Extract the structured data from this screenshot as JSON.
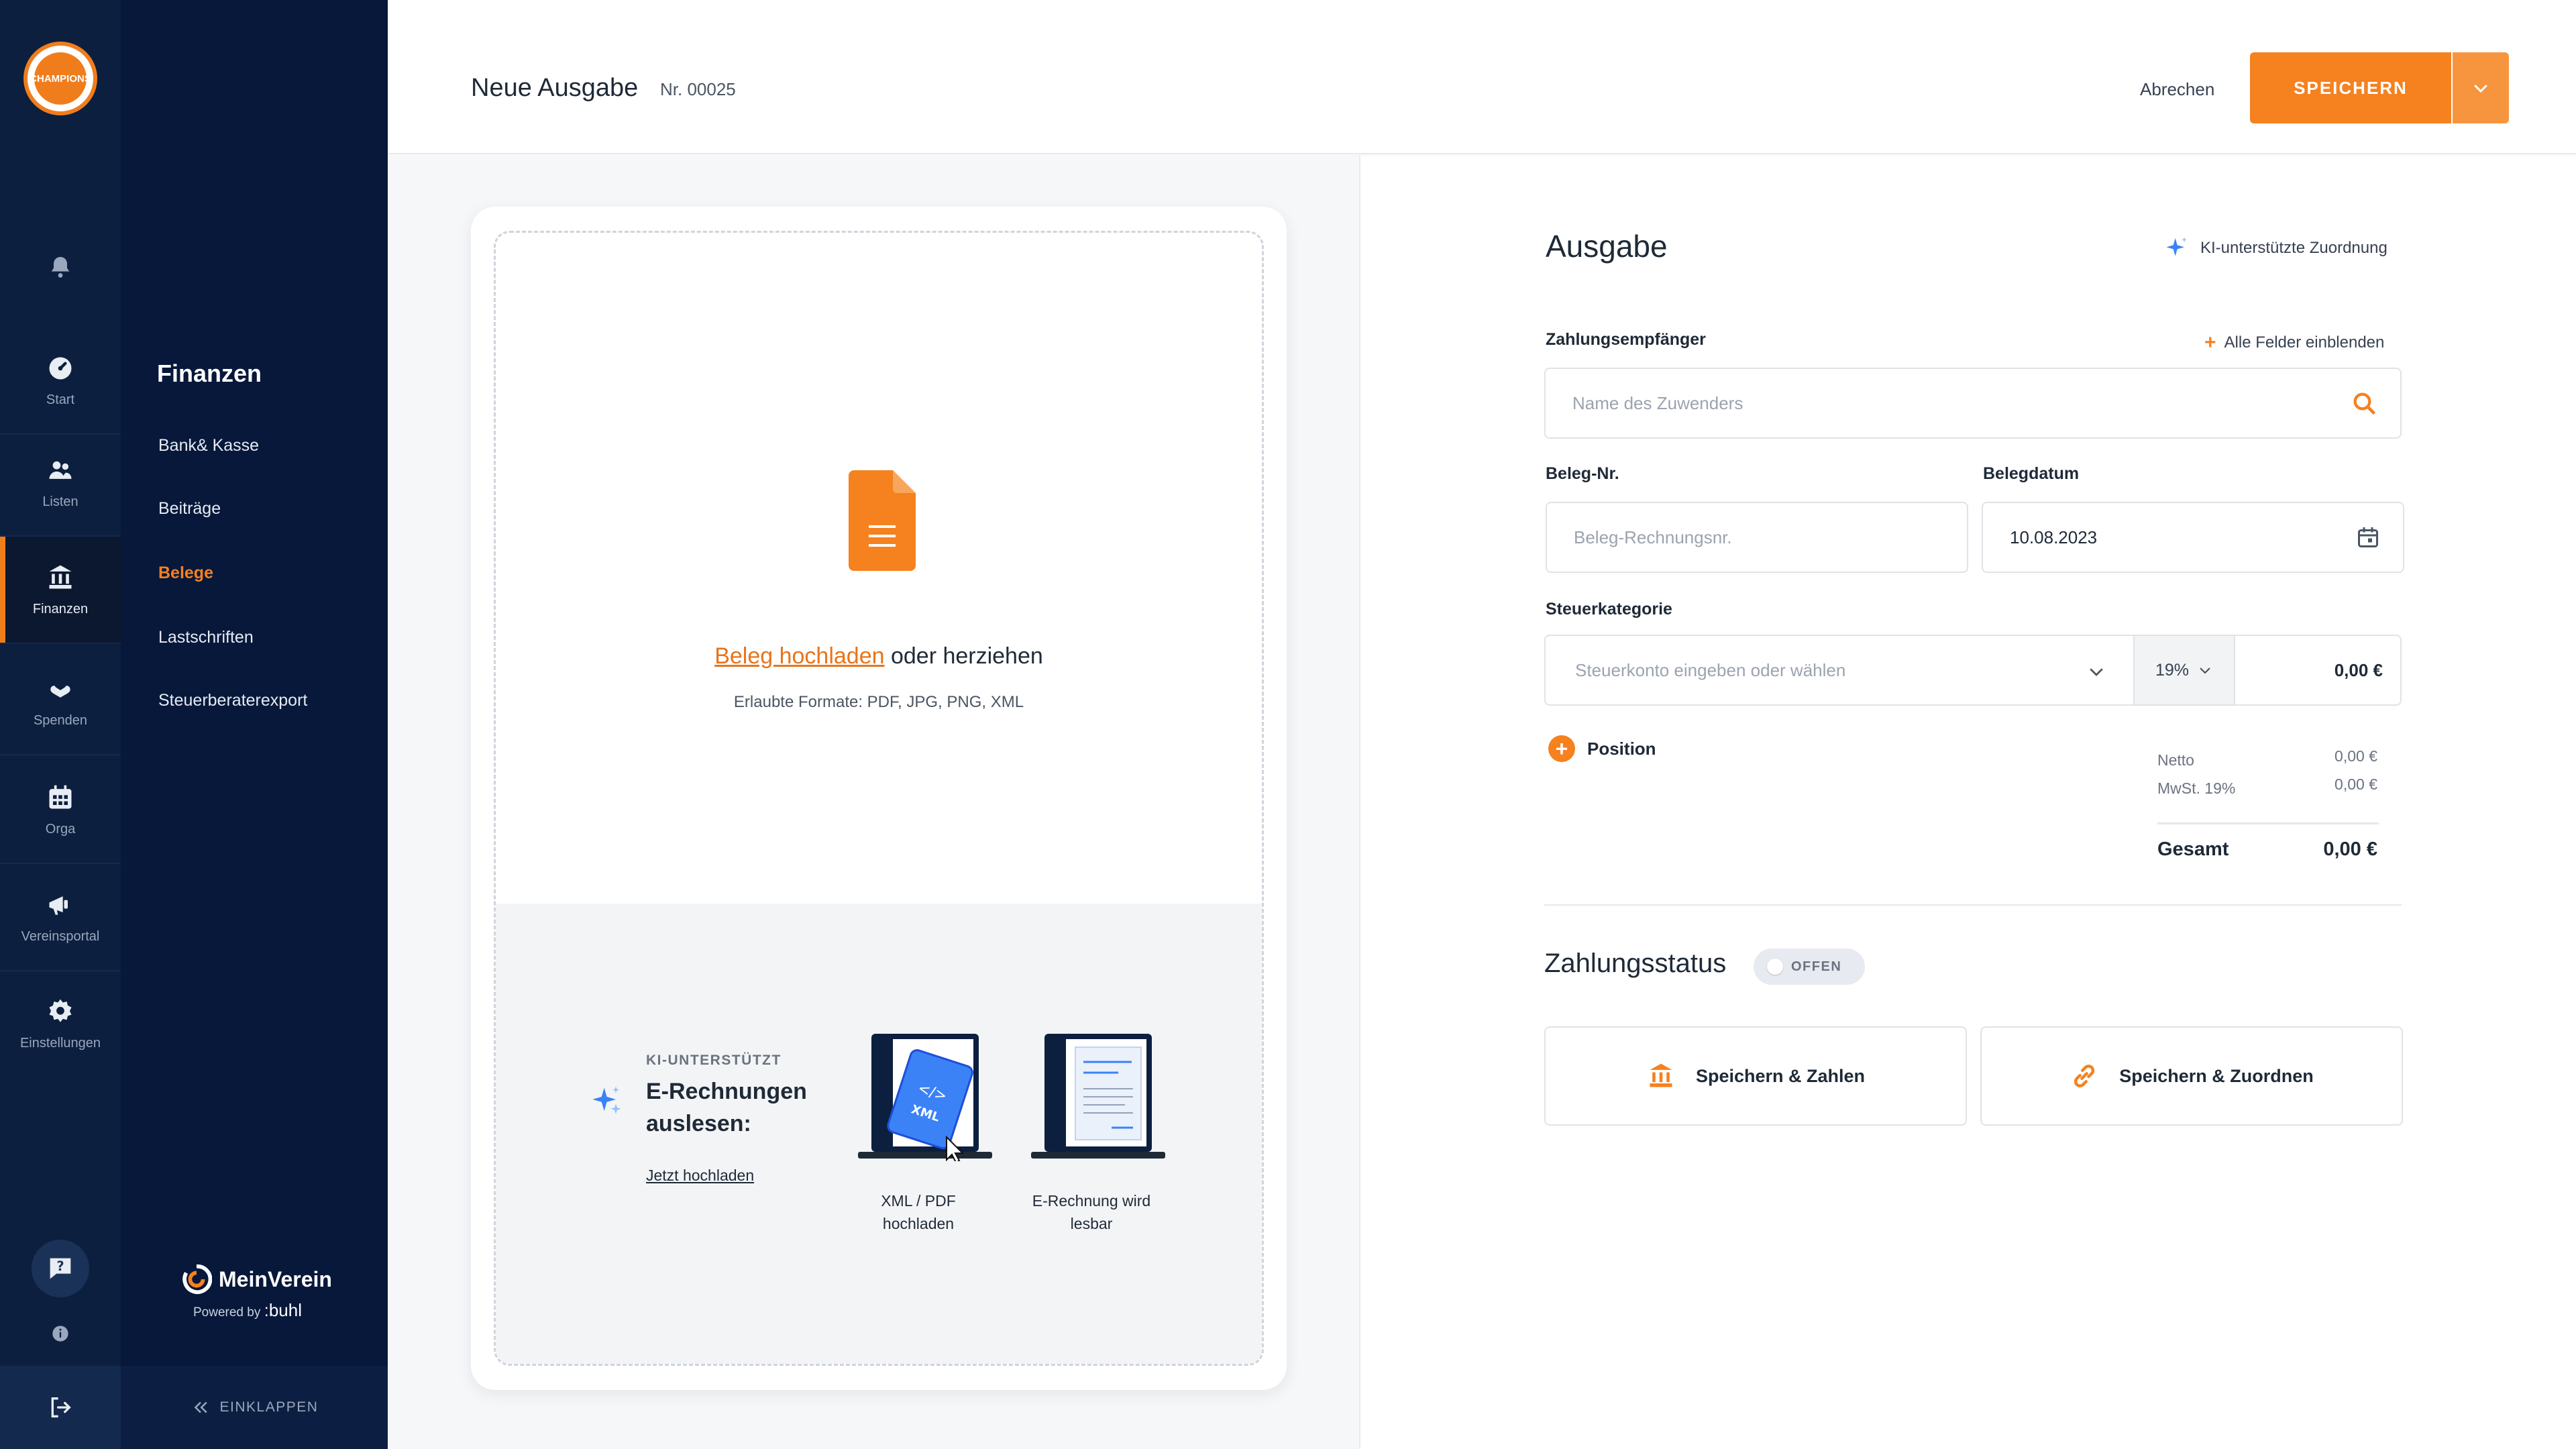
{
  "app": {
    "logo_text": "CHAMPIONS"
  },
  "rail": {
    "items": [
      {
        "label": "Start",
        "icon": "dashboard-icon"
      },
      {
        "label": "Listen",
        "icon": "people-icon"
      },
      {
        "label": "Finanzen",
        "icon": "bank-icon",
        "active": true
      },
      {
        "label": "Spenden",
        "icon": "donation-icon"
      },
      {
        "label": "Orga",
        "icon": "calendar-icon"
      },
      {
        "label": "Vereinsportal",
        "icon": "megaphone-icon"
      },
      {
        "label": "Einstellungen",
        "icon": "gear-icon"
      }
    ]
  },
  "sidebar": {
    "title": "Finanzen",
    "items": [
      {
        "label": "Bank& Kasse"
      },
      {
        "label": "Beiträge"
      },
      {
        "label": "Belege",
        "active": true
      },
      {
        "label": "Lastschriften"
      },
      {
        "label": "Steuerberaterexport"
      }
    ],
    "brand_name": "MeinVerein",
    "powered_by": "Powered by",
    "powered_brand": ":buhl",
    "collapse_label": "EINKLAPPEN"
  },
  "header": {
    "title": "Neue Ausgabe",
    "number": "Nr. 00025",
    "cancel_label": "Abrechen",
    "save_label": "SPEICHERN"
  },
  "upload": {
    "link_text": "Beleg hochladen",
    "rest_text": " oder herziehen",
    "formats": "Erlaubte Formate: PDF, JPG, PNG, XML",
    "ai_tag": "KI-UNTERSTÜTZT",
    "ai_title": "E-Rechnungen auslesen:",
    "ai_link": "Jetzt hochladen",
    "step1": "XML / PDF hochladen",
    "step2": "E-Rechnung wird lesbar",
    "xml_badge": "XML"
  },
  "form": {
    "title": "Ausgabe",
    "ki_label": "KI-unterstützte Zuordnung",
    "payee_label": "Zahlungsempfänger",
    "all_fields_label": "Alle Felder einblenden",
    "payee_placeholder": "Name des Zuwenders",
    "receipt_no_label": "Beleg-Nr.",
    "receipt_no_placeholder": "Beleg-Rechnungsnr.",
    "date_label": "Belegdatum",
    "date_value": "10.08.2023",
    "tax_label": "Steuerkategorie",
    "tax_placeholder": "Steuerkonto eingeben oder wählen",
    "vat_value": "19%",
    "amount_value": "0,00 €",
    "position_label": "Position",
    "netto_label": "Netto",
    "netto_value": "0,00 €",
    "mwst_label": "MwSt. 19%",
    "mwst_value": "0,00 €",
    "gesamt_label": "Gesamt",
    "gesamt_value": "0,00 €",
    "status_title": "Zahlungsstatus",
    "status_badge": "OFFEN",
    "btn_pay": "Speichern & Zahlen",
    "btn_assign": "Speichern & Zuordnen"
  },
  "colors": {
    "accent": "#f5811f",
    "navy": "#07183a",
    "rail": "#0c1f3f"
  }
}
